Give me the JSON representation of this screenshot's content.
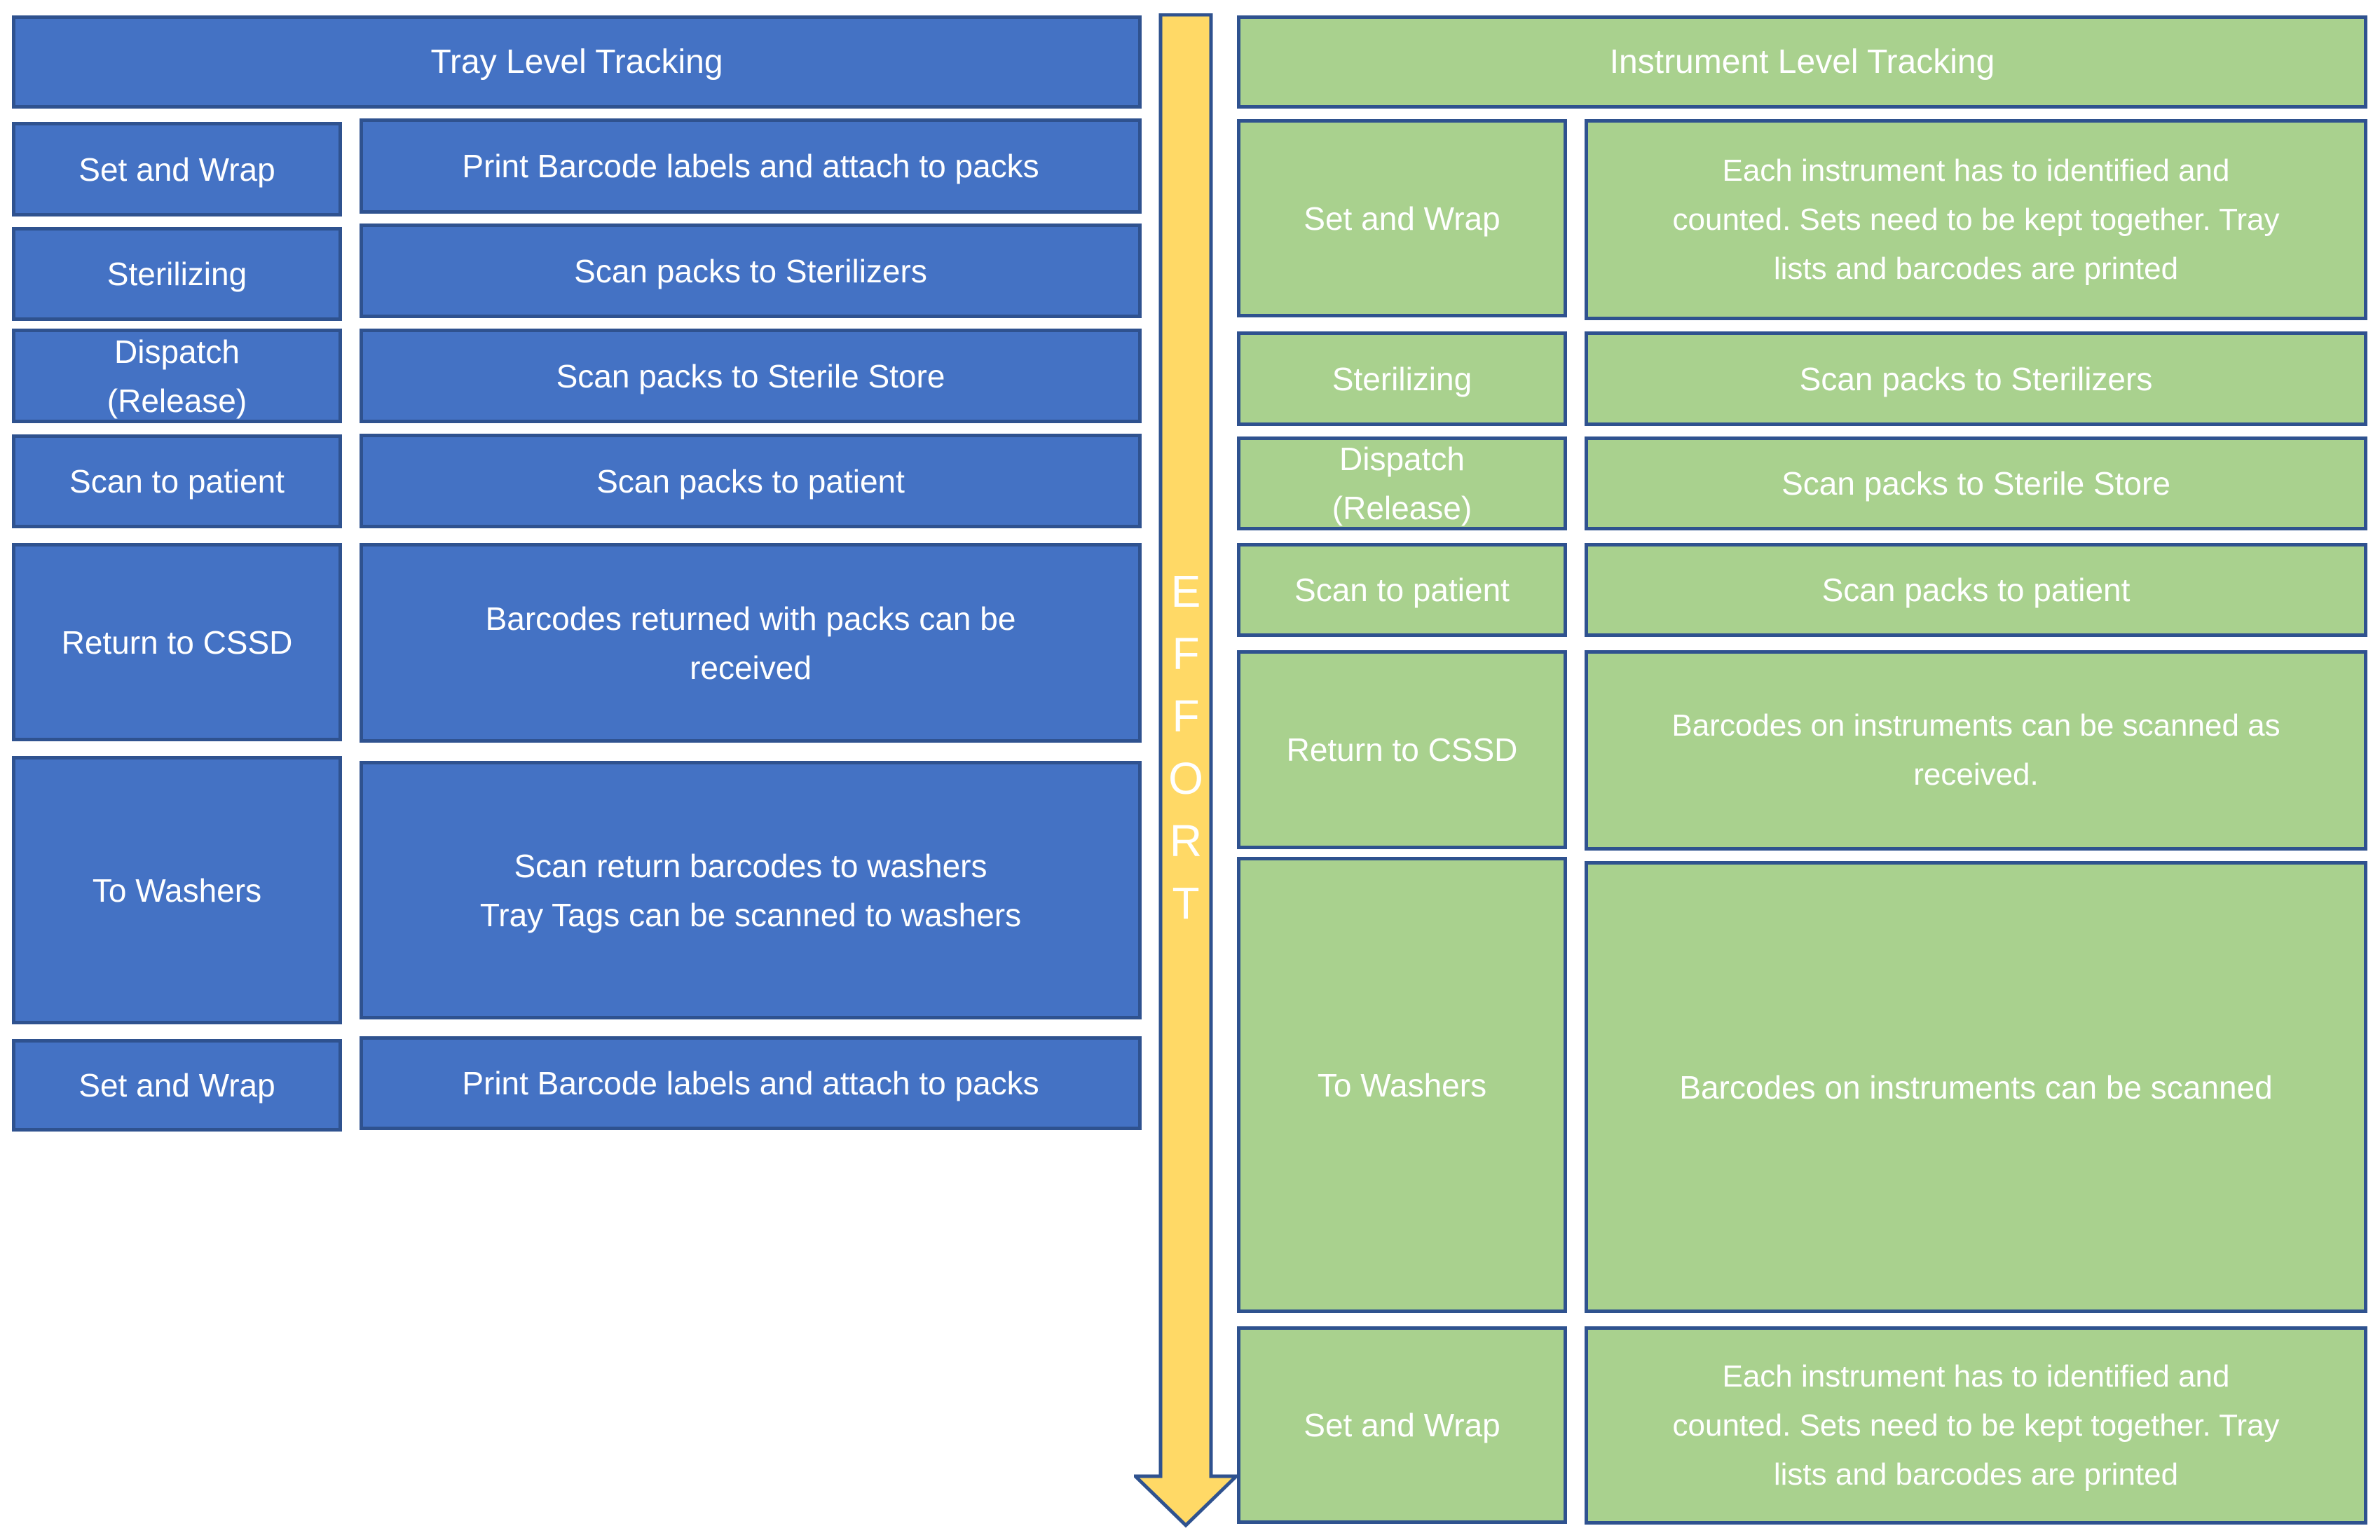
{
  "colors": {
    "tray_fill": "#4472C4",
    "instrument_fill": "#A9D18E",
    "border": "#2F528F",
    "arrow_fill": "#FFD966",
    "text": "#FFFFFF"
  },
  "tray": {
    "title": "Tray Level Tracking",
    "rows": [
      {
        "step": "Set and Wrap",
        "description": "Print Barcode labels and attach to packs"
      },
      {
        "step": "Sterilizing",
        "description": "Scan packs to Sterilizers"
      },
      {
        "step": "Dispatch\n(Release)",
        "description": "Scan packs to Sterile Store"
      },
      {
        "step": "Scan to patient",
        "description": "Scan packs to patient"
      },
      {
        "step": "Return to CSSD",
        "description": "Barcodes returned with packs can be\nreceived"
      },
      {
        "step": "To Washers",
        "description": "Scan return barcodes to washers\nTray Tags can be scanned to washers"
      },
      {
        "step": "Set and Wrap",
        "description": "Print Barcode labels and attach to packs"
      }
    ]
  },
  "arrow": {
    "label_letters": [
      "E",
      "F",
      "F",
      "O",
      "R",
      "T"
    ],
    "label": "EFFORT",
    "direction": "down"
  },
  "instrument": {
    "title": "Instrument Level Tracking",
    "rows": [
      {
        "step": "Set and Wrap",
        "description": "Each instrument has to identified and\ncounted. Sets need to be kept together. Tray\nlists and barcodes are printed"
      },
      {
        "step": "Sterilizing",
        "description": "Scan packs to Sterilizers"
      },
      {
        "step": "Dispatch\n(Release)",
        "description": "Scan packs to Sterile Store"
      },
      {
        "step": "Scan to patient",
        "description": "Scan packs to patient"
      },
      {
        "step": "Return to CSSD",
        "description": "Barcodes on instruments can be scanned as\nreceived."
      },
      {
        "step": "To Washers",
        "description": "Barcodes on instruments can be scanned"
      },
      {
        "step": "Set and Wrap",
        "description": "Each instrument has to identified and\ncounted. Sets need to be kept together. Tray\nlists and barcodes are printed"
      }
    ]
  }
}
